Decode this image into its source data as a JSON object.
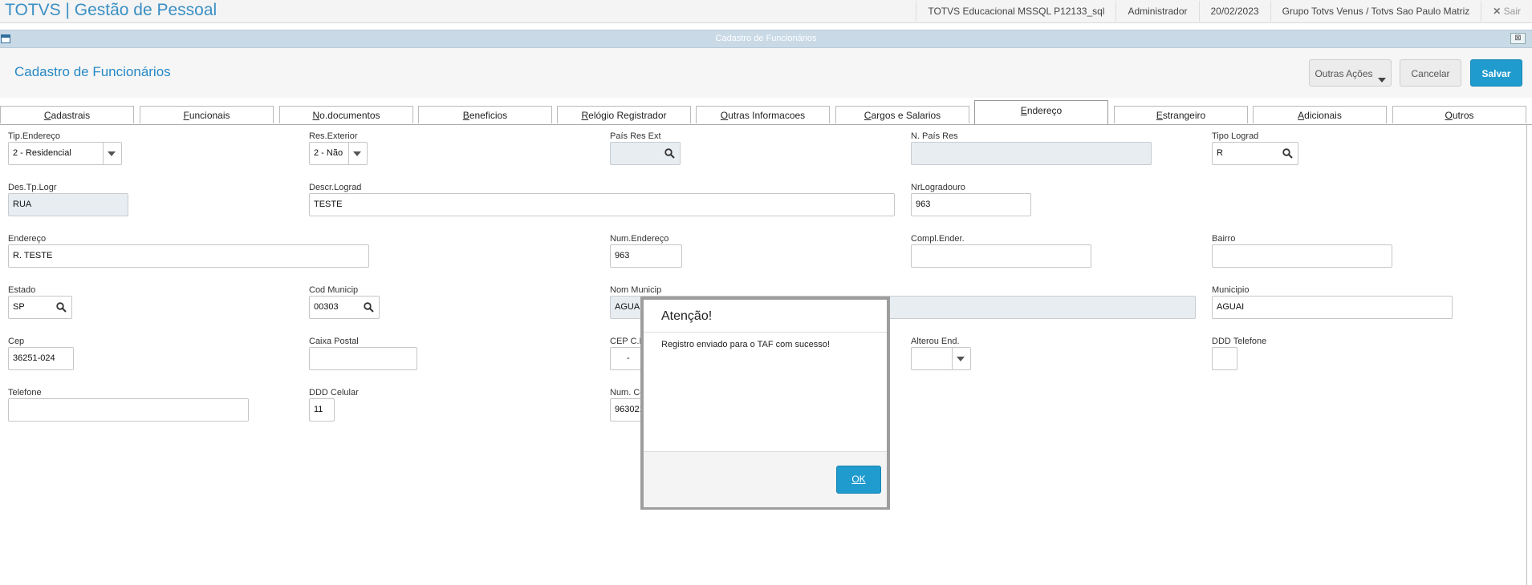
{
  "topbar": {
    "app_title": "TOTVS | Gestão de Pessoal",
    "environment": "TOTVS Educacional MSSQL P12133_sql",
    "user": "Administrador",
    "date": "20/02/2023",
    "company": "Grupo Totvs Venus / Totvs Sao Paulo Matriz",
    "exit_icon": "✕",
    "exit_label": "Sair"
  },
  "window": {
    "title": "Cadastro de Funcionários",
    "close_glyph": "⊠"
  },
  "header": {
    "page_title": "Cadastro de Funcionários",
    "more_actions": "Outras Ações",
    "cancel": "Cancelar",
    "save": "Salvar"
  },
  "tabs": [
    {
      "pre": "",
      "u": "C",
      "post": "adastrais"
    },
    {
      "pre": "",
      "u": "F",
      "post": "uncionais"
    },
    {
      "pre": "",
      "u": "N",
      "post": "o.documentos"
    },
    {
      "pre": "",
      "u": "B",
      "post": "eneficios"
    },
    {
      "pre": "",
      "u": "R",
      "post": "elógio Registrador"
    },
    {
      "pre": "",
      "u": "O",
      "post": "utras Informacoes"
    },
    {
      "pre": "",
      "u": "C",
      "post": "argos e Salarios"
    },
    {
      "pre": "",
      "u": "E",
      "post": "ndereço"
    },
    {
      "pre": "",
      "u": "E",
      "post": "strangeiro"
    },
    {
      "pre": "",
      "u": "A",
      "post": "dicionais"
    },
    {
      "pre": "",
      "u": "O",
      "post": "utros"
    }
  ],
  "form": {
    "tip_endereco": {
      "label": "Tip.Endereço",
      "value": "2 - Residencial"
    },
    "res_exterior": {
      "label": "Res.Exterior",
      "value": "2 - Não"
    },
    "pais_res_ext": {
      "label": "País Res Ext",
      "value": ""
    },
    "n_pais_res": {
      "label": "N. País Res",
      "value": ""
    },
    "tipo_lograd": {
      "label": "Tipo Lograd",
      "value": "R"
    },
    "des_tp_logr": {
      "label": "Des.Tp.Logr",
      "value": "RUA"
    },
    "descr_lograd": {
      "label": "Descr.Lograd",
      "value": "TESTE"
    },
    "nr_logradouro": {
      "label": "NrLogradouro",
      "value": "963"
    },
    "endereco": {
      "label": "Endereço",
      "value": "R. TESTE"
    },
    "num_endereco": {
      "label": "Num.Endereço",
      "value": "963"
    },
    "compl_ender": {
      "label": "Compl.Ender.",
      "value": ""
    },
    "bairro": {
      "label": "Bairro",
      "value": ""
    },
    "estado": {
      "label": "Estado",
      "value": "SP"
    },
    "cod_municip": {
      "label": "Cod Municip",
      "value": "00303"
    },
    "nom_municip": {
      "label": "Nom Municip",
      "value": "AGUAI"
    },
    "municipio": {
      "label": "Municipio",
      "value": "AGUAI"
    },
    "cep": {
      "label": "Cep",
      "value": "36251-024"
    },
    "caixa_postal": {
      "label": "Caixa Postal",
      "value": ""
    },
    "cep_cp": {
      "label": "CEP C.P",
      "value": "-"
    },
    "alterou_end": {
      "label": "Alterou End.",
      "value": ""
    },
    "ddd_telefone": {
      "label": "DDD Telefone",
      "value": ""
    },
    "telefone": {
      "label": "Telefone",
      "value": ""
    },
    "ddd_celular": {
      "label": "DDD Celular",
      "value": "11"
    },
    "num_celular": {
      "label": "Num. Ce",
      "value": "963021"
    }
  },
  "dialog": {
    "title": "Atenção!",
    "message": "Registro enviado para o TAF com sucesso!",
    "ok": "OK"
  }
}
